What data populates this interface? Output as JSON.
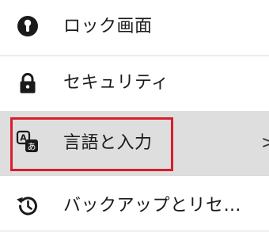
{
  "settings_list": {
    "items": [
      {
        "label": "ロック画面",
        "icon": "lock-screen-keyhole-icon"
      },
      {
        "label": "セキュリティ",
        "icon": "padlock-icon"
      },
      {
        "label": "言語と入力",
        "icon": "language-input-icon",
        "selected": true
      },
      {
        "label": "バックアップとリセ…",
        "icon": "backup-restore-icon"
      }
    ],
    "chevron": ">",
    "language_icon_glyphs": {
      "primary": "A",
      "secondary": "あ"
    }
  },
  "colors": {
    "highlight_border": "#d81e2a",
    "selected_row_bg": "#dedede",
    "text": "#1a1a1a"
  }
}
